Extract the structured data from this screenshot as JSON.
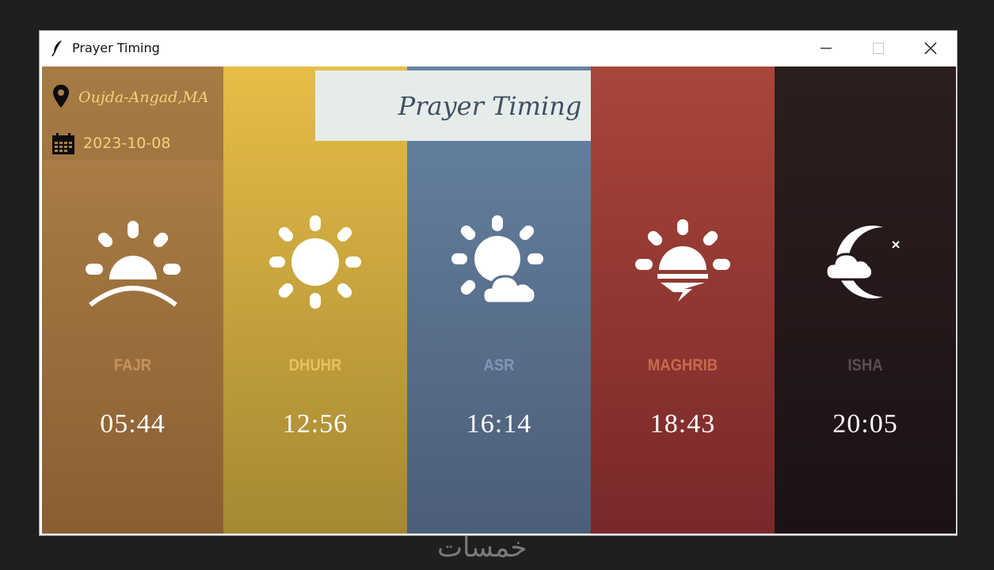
{
  "window": {
    "title": "Prayer Timing",
    "icon": "feather-icon",
    "controls": [
      "minimize-icon",
      "maximize-icon",
      "close-icon"
    ]
  },
  "header": {
    "title": "Prayer Timing"
  },
  "location": {
    "icon": "map-pin-icon",
    "text": "Oujda-Angad,MA"
  },
  "date": {
    "icon": "calendar-icon",
    "text": "2023-10-08"
  },
  "prayers": [
    {
      "name": "FAJR",
      "time": "05:44",
      "icon": "sunrise-icon",
      "name_color": "#c4945a",
      "color_top": "#b08448",
      "color_bottom": "#8a5e33"
    },
    {
      "name": "DHUHR",
      "time": "12:56",
      "icon": "sun-icon",
      "name_color": "#e8c35a",
      "color_top": "#e6bd47",
      "color_bottom": "#a58832"
    },
    {
      "name": "ASR",
      "time": "16:14",
      "icon": "sun-cloud-icon",
      "name_color": "#7f97b4",
      "color_top": "#6784a4",
      "color_bottom": "#4c5e78"
    },
    {
      "name": "MAGHRIB",
      "time": "18:43",
      "icon": "sunset-icon",
      "name_color": "#c86a4a",
      "color_top": "#a8463a",
      "color_bottom": "#79282a"
    },
    {
      "name": "ISHA",
      "time": "20:05",
      "icon": "moon-cloud-icon",
      "name_color": "#5a4f52",
      "color_top": "#2c1e1f",
      "color_bottom": "#1c1214"
    }
  ],
  "watermark": {
    "text": "خمسات"
  }
}
